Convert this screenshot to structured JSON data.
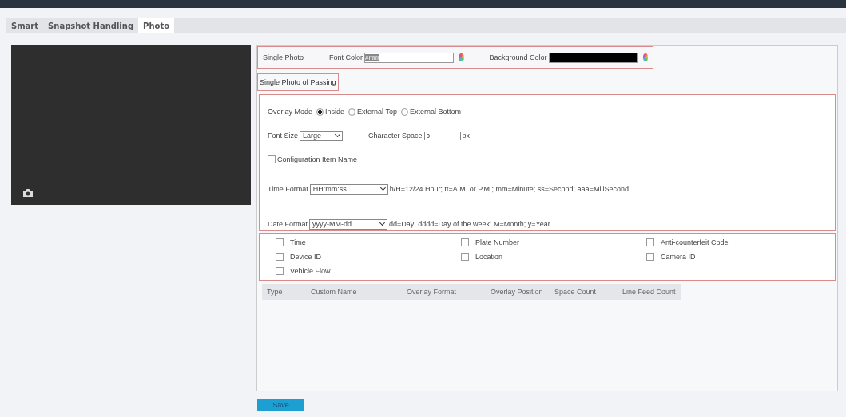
{
  "tabs": [
    {
      "label": "Smart",
      "selected": false
    },
    {
      "label": "Snapshot Handling",
      "selected": false
    },
    {
      "label": "Photo",
      "selected": true
    }
  ],
  "single_photo": {
    "label": "Single Photo",
    "font_color_label": "Font Color",
    "font_color_value": "#ffffff",
    "background_color_label": "Background Color"
  },
  "section_title": "Single Photo of Passing",
  "overlay_mode": {
    "label": "Overlay Mode",
    "options": [
      {
        "label": "Inside",
        "selected": true
      },
      {
        "label": "External Top",
        "selected": false
      },
      {
        "label": "External Bottom",
        "selected": false
      }
    ]
  },
  "font_size": {
    "label": "Font Size",
    "value": "Large"
  },
  "character_space": {
    "label": "Character Space",
    "value": "0",
    "unit": "px"
  },
  "configuration_item_name": {
    "label": "Configuration Item Name",
    "checked": false
  },
  "time_format": {
    "label": "Time Format",
    "value": "HH:mm:ss",
    "hint": "h/H=12/24 Hour; tt=A.M. or P.M.; mm=Minute; ss=Second; aaa=MiliSecond"
  },
  "date_format": {
    "label": "Date Format",
    "value": "yyyy-MM-dd",
    "hint": "dd=Day; dddd=Day of the week; M=Month; y=Year"
  },
  "items": [
    {
      "label": "Time",
      "checked": false
    },
    {
      "label": "Plate Number",
      "checked": false
    },
    {
      "label": "Anti-counterfeit Code",
      "checked": false
    },
    {
      "label": "Device ID",
      "checked": false
    },
    {
      "label": "Location",
      "checked": false
    },
    {
      "label": "Camera ID",
      "checked": false
    },
    {
      "label": "Vehicle Flow",
      "checked": false
    }
  ],
  "table": {
    "columns": [
      "Type",
      "Custom Name",
      "Overlay Format",
      "Overlay Position",
      "Space Count",
      "Line Feed Count"
    ]
  },
  "save_button": "Save"
}
